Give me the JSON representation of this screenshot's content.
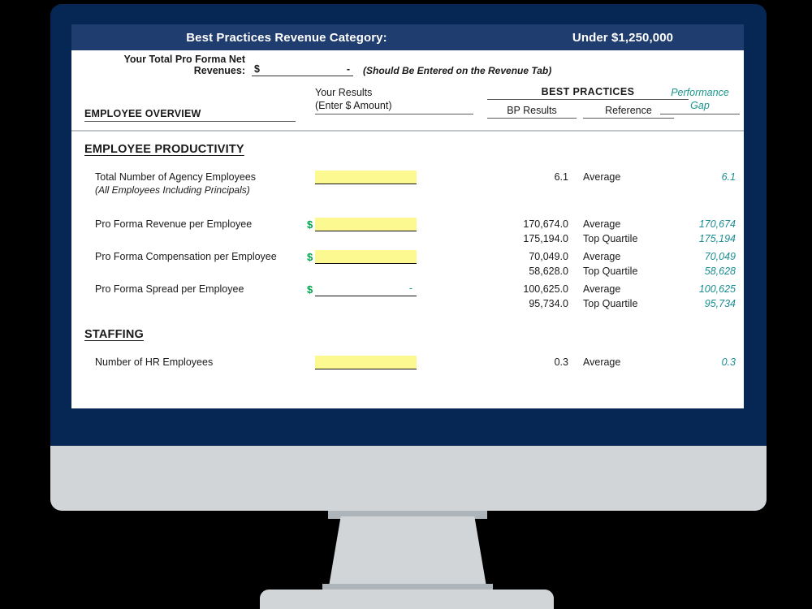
{
  "window": {
    "title_label": "Best Practices Revenue Category:",
    "title_value": "Under $1,250,000"
  },
  "colors": {
    "title_bar": "#1f3d6e",
    "bezel": "#062754",
    "stand": "#d2d5d8",
    "input_highlight": "#fbf98f",
    "gap_teal": "#1a8d92",
    "dollar_green": "#00a550"
  },
  "revenue_row": {
    "label": "Your Total Pro Forma Net Revenues:",
    "currency_symbol": "$",
    "value": "-",
    "note": "(Should Be Entered on the Revenue Tab)"
  },
  "column_headers": {
    "overview": "EMPLOYEE OVERVIEW",
    "your_results_line1": "Your Results",
    "your_results_line2": "(Enter $ Amount)",
    "best_practices": "BEST  PRACTICES",
    "bp_results": "BP Results",
    "reference": "Reference",
    "gap_line1": "Performance",
    "gap_line2": "Gap"
  },
  "sections": [
    {
      "heading": "EMPLOYEE PRODUCTIVITY",
      "rows": [
        {
          "label": "Total Number of Agency Employees",
          "sublabel": "(All Employees Including Principals)",
          "has_dollar": false,
          "input_type": "highlight",
          "input_value": "",
          "lines": [
            {
              "bp": "6.1",
              "ref": "Average",
              "gap": "6.1"
            }
          ]
        },
        {
          "label": "Pro Forma Revenue per Employee",
          "sublabel": "",
          "has_dollar": true,
          "dollar": "$",
          "input_type": "highlight",
          "input_value": "",
          "lines": [
            {
              "bp": "170,674.0",
              "ref": "Average",
              "gap": "170,674"
            },
            {
              "bp": "175,194.0",
              "ref": "Top Quartile",
              "gap": "175,194"
            }
          ]
        },
        {
          "label": "Pro Forma Compensation per Employee",
          "sublabel": "",
          "has_dollar": true,
          "dollar": "$",
          "input_type": "highlight",
          "input_value": "",
          "lines": [
            {
              "bp": "70,049.0",
              "ref": "Average",
              "gap": "70,049"
            },
            {
              "bp": "58,628.0",
              "ref": "Top Quartile",
              "gap": "58,628"
            }
          ]
        },
        {
          "label": "Pro Forma Spread per Employee",
          "sublabel": "",
          "has_dollar": true,
          "dollar": "$",
          "input_type": "blank",
          "input_value": "-",
          "lines": [
            {
              "bp": "100,625.0",
              "ref": "Average",
              "gap": "100,625"
            },
            {
              "bp": "95,734.0",
              "ref": "Top Quartile",
              "gap": "95,734"
            }
          ]
        }
      ]
    },
    {
      "heading": "STAFFING",
      "rows": [
        {
          "label": "Number of HR Employees",
          "sublabel": "",
          "has_dollar": false,
          "input_type": "highlight",
          "input_value": "",
          "lines": [
            {
              "bp": "0.3",
              "ref": "Average",
              "gap": "0.3"
            }
          ]
        }
      ]
    }
  ]
}
